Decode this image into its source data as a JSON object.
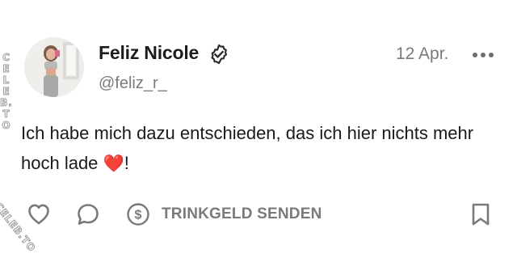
{
  "post": {
    "author_name": "Feliz Nicole",
    "handle": "@feliz_r_",
    "date": "12 Apr.",
    "text_before_emoji": "Ich habe mich dazu entschieden, das ich hier nichts mehr hoch lade ",
    "emoji": "❤️",
    "text_after_emoji": "!"
  },
  "actions": {
    "tip_label": "TRINKGELD SENDEN"
  },
  "watermark": {
    "text": "CELEB.TO"
  },
  "colors": {
    "text": "#1a1a1a",
    "muted": "#7a7a7a",
    "heart_emoji": "#d2202e"
  },
  "icons": [
    "verified-badge-icon",
    "more-dots-icon",
    "heart-icon",
    "comment-bubble-icon",
    "dollar-circle-icon",
    "bookmark-icon"
  ]
}
